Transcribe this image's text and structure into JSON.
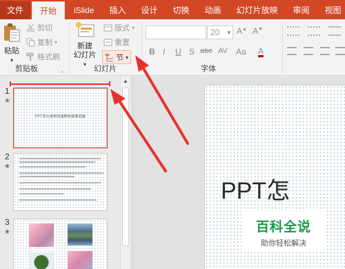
{
  "tabs": [
    {
      "label": "文件",
      "kind": "file"
    },
    {
      "label": "开始",
      "kind": "active"
    },
    {
      "label": "iSlide",
      "kind": "normal"
    },
    {
      "label": "插入",
      "kind": "normal"
    },
    {
      "label": "设计",
      "kind": "normal"
    },
    {
      "label": "切换",
      "kind": "normal"
    },
    {
      "label": "动画",
      "kind": "normal"
    },
    {
      "label": "幻灯片放映",
      "kind": "normal"
    },
    {
      "label": "审阅",
      "kind": "normal"
    },
    {
      "label": "视图",
      "kind": "normal"
    }
  ],
  "clipboard": {
    "paste": "粘贴",
    "cut": "剪切",
    "copy": "复制",
    "format_painter": "格式刷",
    "group_label": "剪贴板"
  },
  "slides_group": {
    "new_slide_line1": "新建",
    "new_slide_line2": "幻灯片",
    "layout": "版式",
    "reset": "重置",
    "section": "节",
    "group_label": "幻灯片"
  },
  "font_group": {
    "font_name": "",
    "font_size": "20",
    "bold": "B",
    "italic": "I",
    "underline": "U",
    "shadow": "S",
    "strike": "abc",
    "spacing": "AV",
    "case": "Aa",
    "group_label": "字体"
  },
  "thumbnails": [
    {
      "number": "1",
      "title": "PPT怎么使用动画刷快速做动画"
    },
    {
      "number": "2"
    },
    {
      "number": "3"
    }
  ],
  "main_slide": {
    "text": "PPT怎"
  },
  "watermark": {
    "top": "百科全说",
    "bottom": "助你轻松解决"
  },
  "colors": {
    "accent": "#d24726",
    "arrow": "#e8312f",
    "watermark_green": "#1a9a48"
  }
}
